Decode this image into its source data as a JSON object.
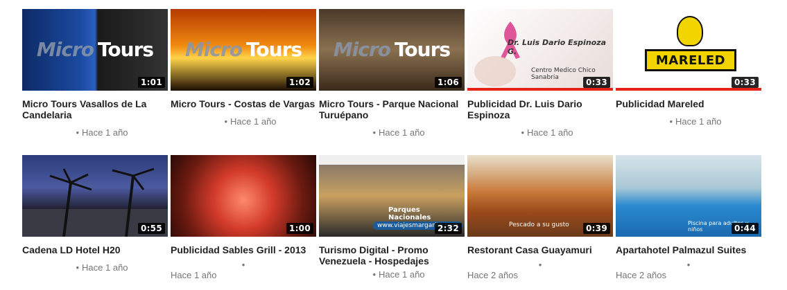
{
  "videos": [
    {
      "title": "Micro Tours Vasallos de La Candelaria",
      "duration": "1:01",
      "age": "Hace 1 año",
      "watched": false
    },
    {
      "title": "Micro Tours - Costas de Vargas",
      "duration": "1:02",
      "age": "Hace 1 año",
      "watched": false
    },
    {
      "title": "Micro Tours - Parque Nacional Turuépano",
      "duration": "1:06",
      "age": "Hace 1 año",
      "watched": false
    },
    {
      "title": "Publicidad Dr. Luis Dario Espinoza",
      "duration": "0:33",
      "age": "Hace 1 año",
      "watched": true
    },
    {
      "title": "Publicidad Mareled",
      "duration": "0:33",
      "age": "Hace 1 año",
      "watched": true
    },
    {
      "title": "Cadena LD Hotel H20",
      "duration": "0:55",
      "age": "Hace 1 año",
      "watched": false
    },
    {
      "title": "Publicidad Sables Grill - 2013",
      "duration": "1:00",
      "age": "Hace 1 año",
      "watched": false
    },
    {
      "title": "Turismo Digital - Promo Venezuela - Hospedajes",
      "duration": "2:32",
      "age": "Hace 1 año",
      "watched": false
    },
    {
      "title": "Restorant Casa Guayamuri",
      "duration": "0:39",
      "age": "Hace 2 años",
      "watched": false
    },
    {
      "title": "Apartahotel Palmazul Suites",
      "duration": "0:44",
      "age": "Hace 2 años",
      "watched": false
    }
  ],
  "thumb_text": {
    "logo_left": "Micro",
    "logo_right": "Tours",
    "medic_name": "Dr. Luis Dario Espinoza G.",
    "medic_center": "Centro Medico Chico Sanabria",
    "mareled": "MARELED",
    "beach_caption": "Parques Nacionales",
    "beach_url": "www.viajesmargarita.com",
    "food_caption": "Pescado a su gusto",
    "pool_caption": "Piscina para adultos y niños"
  },
  "colors": {
    "watched_bar": "#e62117",
    "title_text": "#222222",
    "meta_text": "#767676"
  },
  "icons": {
    "meta_separator": "•"
  }
}
